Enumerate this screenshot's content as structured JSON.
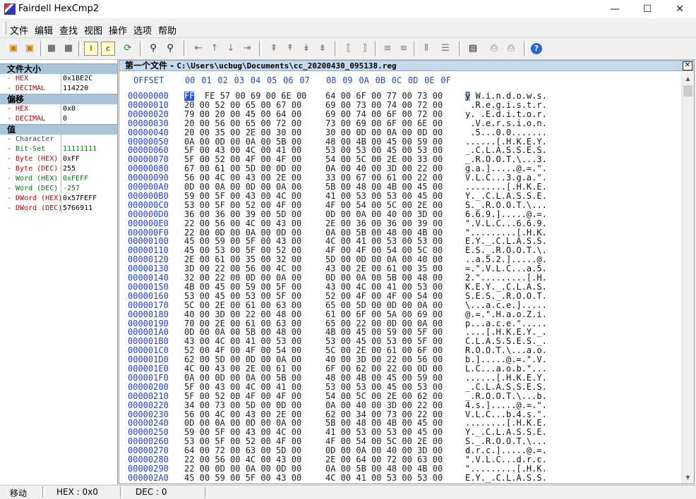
{
  "window": {
    "title": "Fairdell HexCmp2",
    "minimize": "—",
    "maximize": "☐",
    "close": "✕"
  },
  "menu": [
    "文件",
    "编辑",
    "查找",
    "视图",
    "操作",
    "选项",
    "帮助"
  ],
  "info_panel": {
    "sections": [
      {
        "title": "文件大小",
        "rows": [
          {
            "key": "- HEX",
            "value": "0x1BE2C",
            "style": "red"
          },
          {
            "key": "- DECIMAL",
            "value": "114220",
            "style": "red"
          }
        ]
      },
      {
        "title": "偏移",
        "rows": [
          {
            "key": "- HEX",
            "value": "0x0",
            "style": "red"
          },
          {
            "key": "- DECIMAL",
            "value": "0",
            "style": "red"
          }
        ]
      },
      {
        "title": "值",
        "rows": [
          {
            "key": "- Character",
            "value": "",
            "style": "red"
          },
          {
            "key": "- Bit-Set",
            "value": "11111111",
            "style": "green"
          },
          {
            "key": "- Byte (HEX)",
            "value": "0xFF",
            "style": "red"
          },
          {
            "key": "- Byte (DEC)",
            "value": "255",
            "style": "red"
          },
          {
            "key": "- Word (HEX)",
            "value": "0xFEFF",
            "style": "green"
          },
          {
            "key": "- Word (DEC)",
            "value": "-257",
            "style": "green"
          },
          {
            "key": "- DWord (HEX)",
            "value": "0x57FEFF",
            "style": "red"
          },
          {
            "key": "- DWord (DEC)",
            "value": "5766911",
            "style": "red"
          }
        ]
      }
    ]
  },
  "file_view": {
    "label": "第一个文件 - ",
    "path": "C:\\Users\\ucbug\\Documents\\cc_20200430_095138.reg",
    "offset_header": "OFFSET",
    "columns": [
      "00",
      "01",
      "02",
      "03",
      "04",
      "05",
      "06",
      "07",
      "08",
      "09",
      "0A",
      "0B",
      "0C",
      "0D",
      "0E",
      "0F"
    ],
    "rows": [
      {
        "o": "00000000",
        "h1": "  FE 57 00 69 00 6E 00",
        "h2": "64 00 6F 00 77 00 73 00",
        "a": " W.i.n.d.o.w.s.",
        "cur": "FF",
        "curA": "ÿ"
      },
      {
        "o": "00000010",
        "h1": "20 00 52 00 65 00 67 00",
        "h2": "69 00 73 00 74 00 72 00",
        "a": " .R.e.g.i.s.t.r."
      },
      {
        "o": "00000020",
        "h1": "79 00 20 00 45 00 64 00",
        "h2": "69 00 74 00 6F 00 72 00",
        "a": "y. .E.d.i.t.o.r."
      },
      {
        "o": "00000030",
        "h1": "20 00 56 00 65 00 72 00",
        "h2": "73 00 69 00 6F 00 6E 00",
        "a": " .V.e.r.s.i.o.n."
      },
      {
        "o": "00000040",
        "h1": "20 00 35 00 2E 00 30 00",
        "h2": "30 00 0D 00 0A 00 0D 00",
        "a": " .5...0.0......."
      },
      {
        "o": "00000050",
        "h1": "0A 00 0D 00 0A 00 5B 00",
        "h2": "48 00 4B 00 45 00 59 00",
        "a": "......[.H.K.E.Y."
      },
      {
        "o": "00000060",
        "h1": "5F 00 43 00 4C 00 41 00",
        "h2": "53 00 53 00 45 00 53 00",
        "a": "_.C.L.A.S.S.E.S."
      },
      {
        "o": "00000070",
        "h1": "5F 00 52 00 4F 00 4F 00",
        "h2": "54 00 5C 00 2E 00 33 00",
        "a": "_.R.O.O.T.\\...3."
      },
      {
        "o": "00000080",
        "h1": "67 00 61 00 5D 00 0D 00",
        "h2": "0A 00 40 00 3D 00 22 00",
        "a": "g.a.].....@.=.\"."
      },
      {
        "o": "00000090",
        "h1": "56 00 4C 00 43 00 2E 00",
        "h2": "33 00 67 00 61 00 22 00",
        "a": "V.L.C...3.g.a.\"."
      },
      {
        "o": "000000A0",
        "h1": "0D 00 0A 00 0D 00 0A 00",
        "h2": "5B 00 48 00 4B 00 45 00",
        "a": "........[.H.K.E."
      },
      {
        "o": "000000B0",
        "h1": "59 00 5F 00 43 00 4C 00",
        "h2": "41 00 53 00 53 00 45 00",
        "a": "Y._.C.L.A.S.S.E."
      },
      {
        "o": "000000C0",
        "h1": "53 00 5F 00 52 00 4F 00",
        "h2": "4F 00 54 00 5C 00 2E 00",
        "a": "S._.R.O.O.T.\\..."
      },
      {
        "o": "000000D0",
        "h1": "36 00 36 00 39 00 5D 00",
        "h2": "0D 00 0A 00 40 00 3D 00",
        "a": "6.6.9.].....@.=."
      },
      {
        "o": "000000E0",
        "h1": "22 00 56 00 4C 00 43 00",
        "h2": "2E 00 36 00 36 00 39 00",
        "a": "\".V.L.C...6.6.9."
      },
      {
        "o": "000000F0",
        "h1": "22 00 0D 00 0A 00 0D 00",
        "h2": "0A 00 5B 00 48 00 4B 00",
        "a": "\".........[.H.K."
      },
      {
        "o": "00000100",
        "h1": "45 00 59 00 5F 00 43 00",
        "h2": "4C 00 41 00 53 00 53 00",
        "a": "E.Y._.C.L.A.S.S."
      },
      {
        "o": "00000110",
        "h1": "45 00 53 00 5F 00 52 00",
        "h2": "4F 00 4F 00 54 00 5C 00",
        "a": "E.S._.R.O.O.T.\\."
      },
      {
        "o": "00000120",
        "h1": "2E 00 61 00 35 00 32 00",
        "h2": "5D 00 0D 00 0A 00 40 00",
        "a": "..a.5.2.].....@."
      },
      {
        "o": "00000130",
        "h1": "3D 00 22 00 56 00 4C 00",
        "h2": "43 00 2E 00 61 00 35 00",
        "a": "=.\".V.L.C...a.5."
      },
      {
        "o": "00000140",
        "h1": "32 00 22 00 0D 00 0A 00",
        "h2": "0D 00 0A 00 5B 00 48 00",
        "a": "2.\".........[.H."
      },
      {
        "o": "00000150",
        "h1": "4B 00 45 00 59 00 5F 00",
        "h2": "43 00 4C 00 41 00 53 00",
        "a": "K.E.Y._.C.L.A.S."
      },
      {
        "o": "00000160",
        "h1": "53 00 45 00 53 00 5F 00",
        "h2": "52 00 4F 00 4F 00 54 00",
        "a": "S.E.S._.R.O.O.T."
      },
      {
        "o": "00000170",
        "h1": "5C 00 2E 00 61 00 63 00",
        "h2": "65 00 5D 00 0D 00 0A 00",
        "a": "\\...a.c.e.]....."
      },
      {
        "o": "00000180",
        "h1": "40 00 3D 00 22 00 48 00",
        "h2": "61 00 6F 00 5A 00 69 00",
        "a": "@.=.\".H.a.o.Z.i."
      },
      {
        "o": "00000190",
        "h1": "70 00 2E 00 61 00 63 00",
        "h2": "65 00 22 00 0D 00 0A 00",
        "a": "p...a.c.e.\"....."
      },
      {
        "o": "000001A0",
        "h1": "0D 00 0A 00 5B 00 48 00",
        "h2": "4B 00 45 00 59 00 5F 00",
        "a": "....[.H.K.E.Y._."
      },
      {
        "o": "000001B0",
        "h1": "43 00 4C 00 41 00 53 00",
        "h2": "53 00 45 00 53 00 5F 00",
        "a": "C.L.A.S.S.E.S._."
      },
      {
        "o": "000001C0",
        "h1": "52 00 4F 00 4F 00 54 00",
        "h2": "5C 00 2E 00 61 00 6F 00",
        "a": "R.O.O.T.\\...a.o."
      },
      {
        "o": "000001D0",
        "h1": "62 00 5D 00 0D 00 0A 00",
        "h2": "40 00 3D 00 22 00 56 00",
        "a": "b.].....@.=.\".V."
      },
      {
        "o": "000001E0",
        "h1": "4C 00 43 00 2E 00 61 00",
        "h2": "6F 00 62 00 22 00 0D 00",
        "a": "L.C...a.o.b.\"..."
      },
      {
        "o": "000001F0",
        "h1": "0A 00 0D 00 0A 00 5B 00",
        "h2": "48 00 4B 00 45 00 59 00",
        "a": "......[.H.K.E.Y."
      },
      {
        "o": "00000200",
        "h1": "5F 00 43 00 4C 00 41 00",
        "h2": "53 00 53 00 45 00 53 00",
        "a": "_.C.L.A.S.S.E.S."
      },
      {
        "o": "00000210",
        "h1": "5F 00 52 00 4F 00 4F 00",
        "h2": "54 00 5C 00 2E 00 62 00",
        "a": "_.R.O.O.T.\\...b."
      },
      {
        "o": "00000220",
        "h1": "34 00 73 00 5D 00 0D 00",
        "h2": "0A 00 40 00 3D 00 22 00",
        "a": "4.s.].....@.=.\"."
      },
      {
        "o": "00000230",
        "h1": "56 00 4C 00 43 00 2E 00",
        "h2": "62 00 34 00 73 00 22 00",
        "a": "V.L.C...b.4.s.\"."
      },
      {
        "o": "00000240",
        "h1": "0D 00 0A 00 0D 00 0A 00",
        "h2": "5B 00 48 00 4B 00 45 00",
        "a": "........[.H.K.E."
      },
      {
        "o": "00000250",
        "h1": "59 00 5F 00 43 00 4C 00",
        "h2": "41 00 53 00 53 00 45 00",
        "a": "Y._.C.L.A.S.S.E."
      },
      {
        "o": "00000260",
        "h1": "53 00 5F 00 52 00 4F 00",
        "h2": "4F 00 54 00 5C 00 2E 00",
        "a": "S._.R.O.O.T.\\..."
      },
      {
        "o": "00000270",
        "h1": "64 00 72 00 63 00 5D 00",
        "h2": "0D 00 0A 00 40 00 3D 00",
        "a": "d.r.c.].....@.=."
      },
      {
        "o": "00000280",
        "h1": "22 00 56 00 4C 00 43 00",
        "h2": "2E 00 64 00 72 00 63 00",
        "a": "\".V.L.C...d.r.c."
      },
      {
        "o": "00000290",
        "h1": "22 00 0D 00 0A 00 0D 00",
        "h2": "0A 00 5B 00 48 00 4B 00",
        "a": "\".........[.H.K."
      },
      {
        "o": "000002A0",
        "h1": "45 00 59 00 5F 00 43 00",
        "h2": "4C 00 41 00 53 00 53 00",
        "a": "E.Y._.C.L.A.S.S."
      }
    ]
  },
  "status": {
    "mode": "移动",
    "hex": "HEX : 0x0",
    "dec": "DEC : 0"
  },
  "colors": {
    "offset_blue": "#1f3fd1",
    "header_bg": "#c5d9ec",
    "section_bg": "#a9c4d9",
    "cursor": "#2b55d8"
  }
}
